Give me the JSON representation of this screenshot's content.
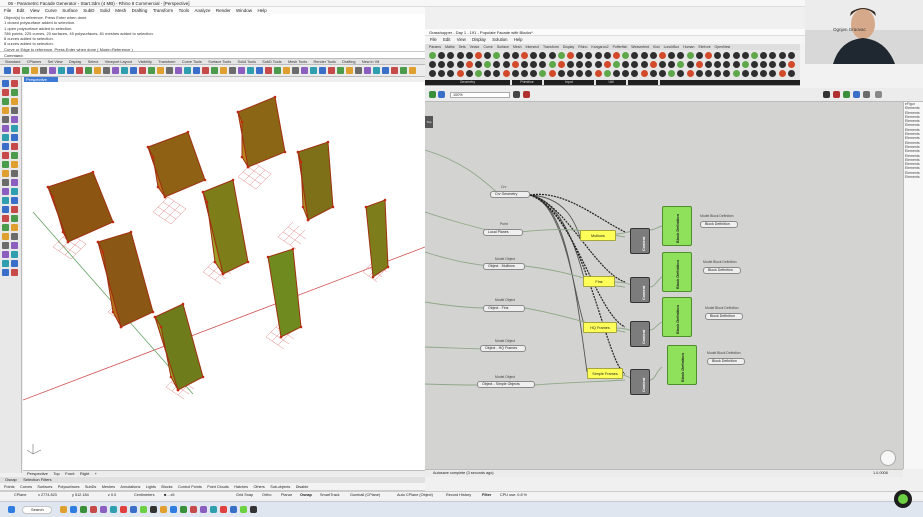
{
  "rhino": {
    "title": "06 - Parametric Facade Generator - Start.3dm (4 MB) - Rhino 8 Commercial - [Perspective]",
    "menu": [
      "File",
      "Edit",
      "View",
      "Curve",
      "Surface",
      "SubD",
      "Solid",
      "Mesh",
      "Drafting",
      "Transform",
      "Tools",
      "Analyze",
      "Render",
      "Window",
      "Help"
    ],
    "command_history": [
      "Object(s) to reference. Press Enter when done",
      "1 closed polysurface added to selection.",
      "1 open polysurface added to selection.",
      "786 points, 225 curves, 20 surfaces, 45 polysurfaces, 81 meshes added to selection.",
      "8 curves added to selection.",
      "8 curves added to selection.",
      "Curve or Edge to reference. Press Enter when done ( Mode=Reference )"
    ],
    "command_prompt": "Command:",
    "toolbar_tabs": [
      "Standard",
      "CPlanes",
      "Set View",
      "Display",
      "Select",
      "Viewport Layout",
      "Visibility",
      "Transform",
      "Curve Tools",
      "Surface Tools",
      "Solid Tools",
      "SubD Tools",
      "Mesh Tools",
      "Render Tools",
      "Drafting",
      "New in V8"
    ],
    "viewport_label": "Perspective",
    "viewport_tabs": [
      "Perspective",
      "Top",
      "Front",
      "Right",
      "+"
    ],
    "osnap_tabs": [
      "Osnap",
      "Selection Filters"
    ],
    "osnaps": [
      "Points",
      "Curves",
      "Surfaces",
      "Polysurfaces",
      "SubDs",
      "Meshes",
      "Annotations",
      "Lights",
      "Blocks",
      "Control Points",
      "Point Clouds",
      "Hatches",
      "Others",
      "Sub-objects",
      "Disable"
    ],
    "status": {
      "cplane": "CPlane",
      "x": "x 2774.823",
      "y": "y 512.184",
      "z": "z 0.0",
      "units": "Centimeters",
      "layer": "■ ...x5",
      "grid_snap": "Grid Snap",
      "ortho": "Ortho",
      "planar": "Planar",
      "osnap": "Osnap",
      "smarttrack": "SmartTrack",
      "gumball": "Gumball (CPlane)",
      "autocplane": "Auto CPlane (Object)",
      "record_history": "Record History",
      "filter": "Filter",
      "cpu": "CPU use: 0.8 %"
    }
  },
  "grasshopper": {
    "title": "Grasshopper - Day 1 - 191 - Populate Facade with Blocks*",
    "menu": [
      "File",
      "Edit",
      "View",
      "Display",
      "Solution",
      "Help"
    ],
    "tabs": [
      "Params",
      "Maths",
      "Sets",
      "Vector",
      "Curve",
      "Surface",
      "Mesh",
      "Intersect",
      "Transform",
      "Display",
      "Rhino",
      "Kangaroo2",
      "Pufferfish",
      "Weaverbird",
      "Kiwi",
      "LunchBox",
      "Human",
      "Elefront",
      "OpenNest"
    ],
    "categories": [
      "Geometry",
      "Primitive",
      "Input",
      "Util"
    ],
    "zoom": "100%",
    "status_left": "Autosave complete (3 seconds ago)",
    "status_right": "1.0.0008",
    "right_panel": [
      "eFigur",
      "Elements",
      "Elements",
      "Elements",
      "Elements",
      "Elements",
      "Elements",
      "Elements",
      "Elements",
      "Elements",
      "Elements",
      "Elements",
      "Elements",
      "Elements",
      "Elements",
      "Elements",
      "Elements",
      "Elements"
    ],
    "canvas": {
      "side_label": "Top",
      "nodes": {
        "crv_label": "Crv",
        "crv_panel": "Crv Geometry",
        "point_label": "Point",
        "point_panel": "Local Planes",
        "mo1_label": "Model Object",
        "mo1_panel": "Object - Mullions",
        "mo2_label": "Model Object",
        "mo2_panel": "Object - Fins",
        "mo3_label": "Model Object",
        "mo3_panel": "Object - HQ Frames",
        "mo4_label": "Model Object",
        "mo4_panel": "Object - Simple Objects",
        "y1": "Mullions",
        "y2": "Fins",
        "y3": "HQ Frames",
        "y4": "Simple Frames",
        "content": "Content",
        "block_def": "Block Definition",
        "out_label": "Model Block Definition",
        "out_panel": "Block Definition"
      }
    }
  },
  "webcam": {
    "name": "Ognjen Graovac"
  },
  "taskbar": {
    "search": "Search"
  }
}
